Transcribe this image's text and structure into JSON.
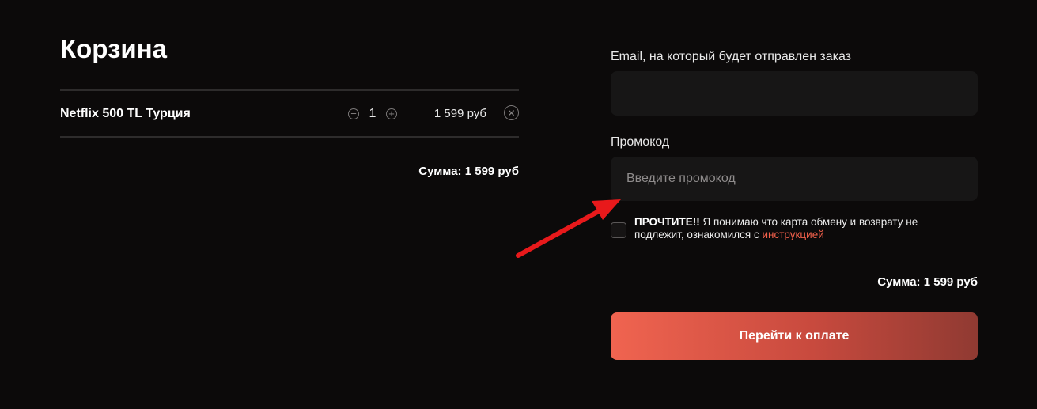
{
  "cart": {
    "title": "Корзина",
    "items": [
      {
        "name": "Netflix 500 TL Турция",
        "quantity": "1",
        "price": "1 599 руб"
      }
    ],
    "total": "Сумма: 1 599 руб"
  },
  "form": {
    "email_label": "Email, на который будет отправлен заказ",
    "email_value": "",
    "promo_label": "Промокод",
    "promo_placeholder": "Введите промокод",
    "agree_strong": "ПРОЧТИТЕ!!",
    "agree_text": " Я понимаю что карта обмену и возврату не подлежит, ознакомился с ",
    "agree_link": "инструкцией",
    "total": "Сумма: 1 599 руб",
    "pay_label": "Перейти к оплате"
  },
  "icons": {
    "minus": "minus-circle-icon",
    "plus": "plus-circle-icon",
    "remove": "close-circle-icon"
  },
  "colors": {
    "background": "#0c0a0a",
    "input_bg": "#171616",
    "accent": "#f06450",
    "accent_dark": "#903a32",
    "annotation_arrow": "#e8191b"
  }
}
